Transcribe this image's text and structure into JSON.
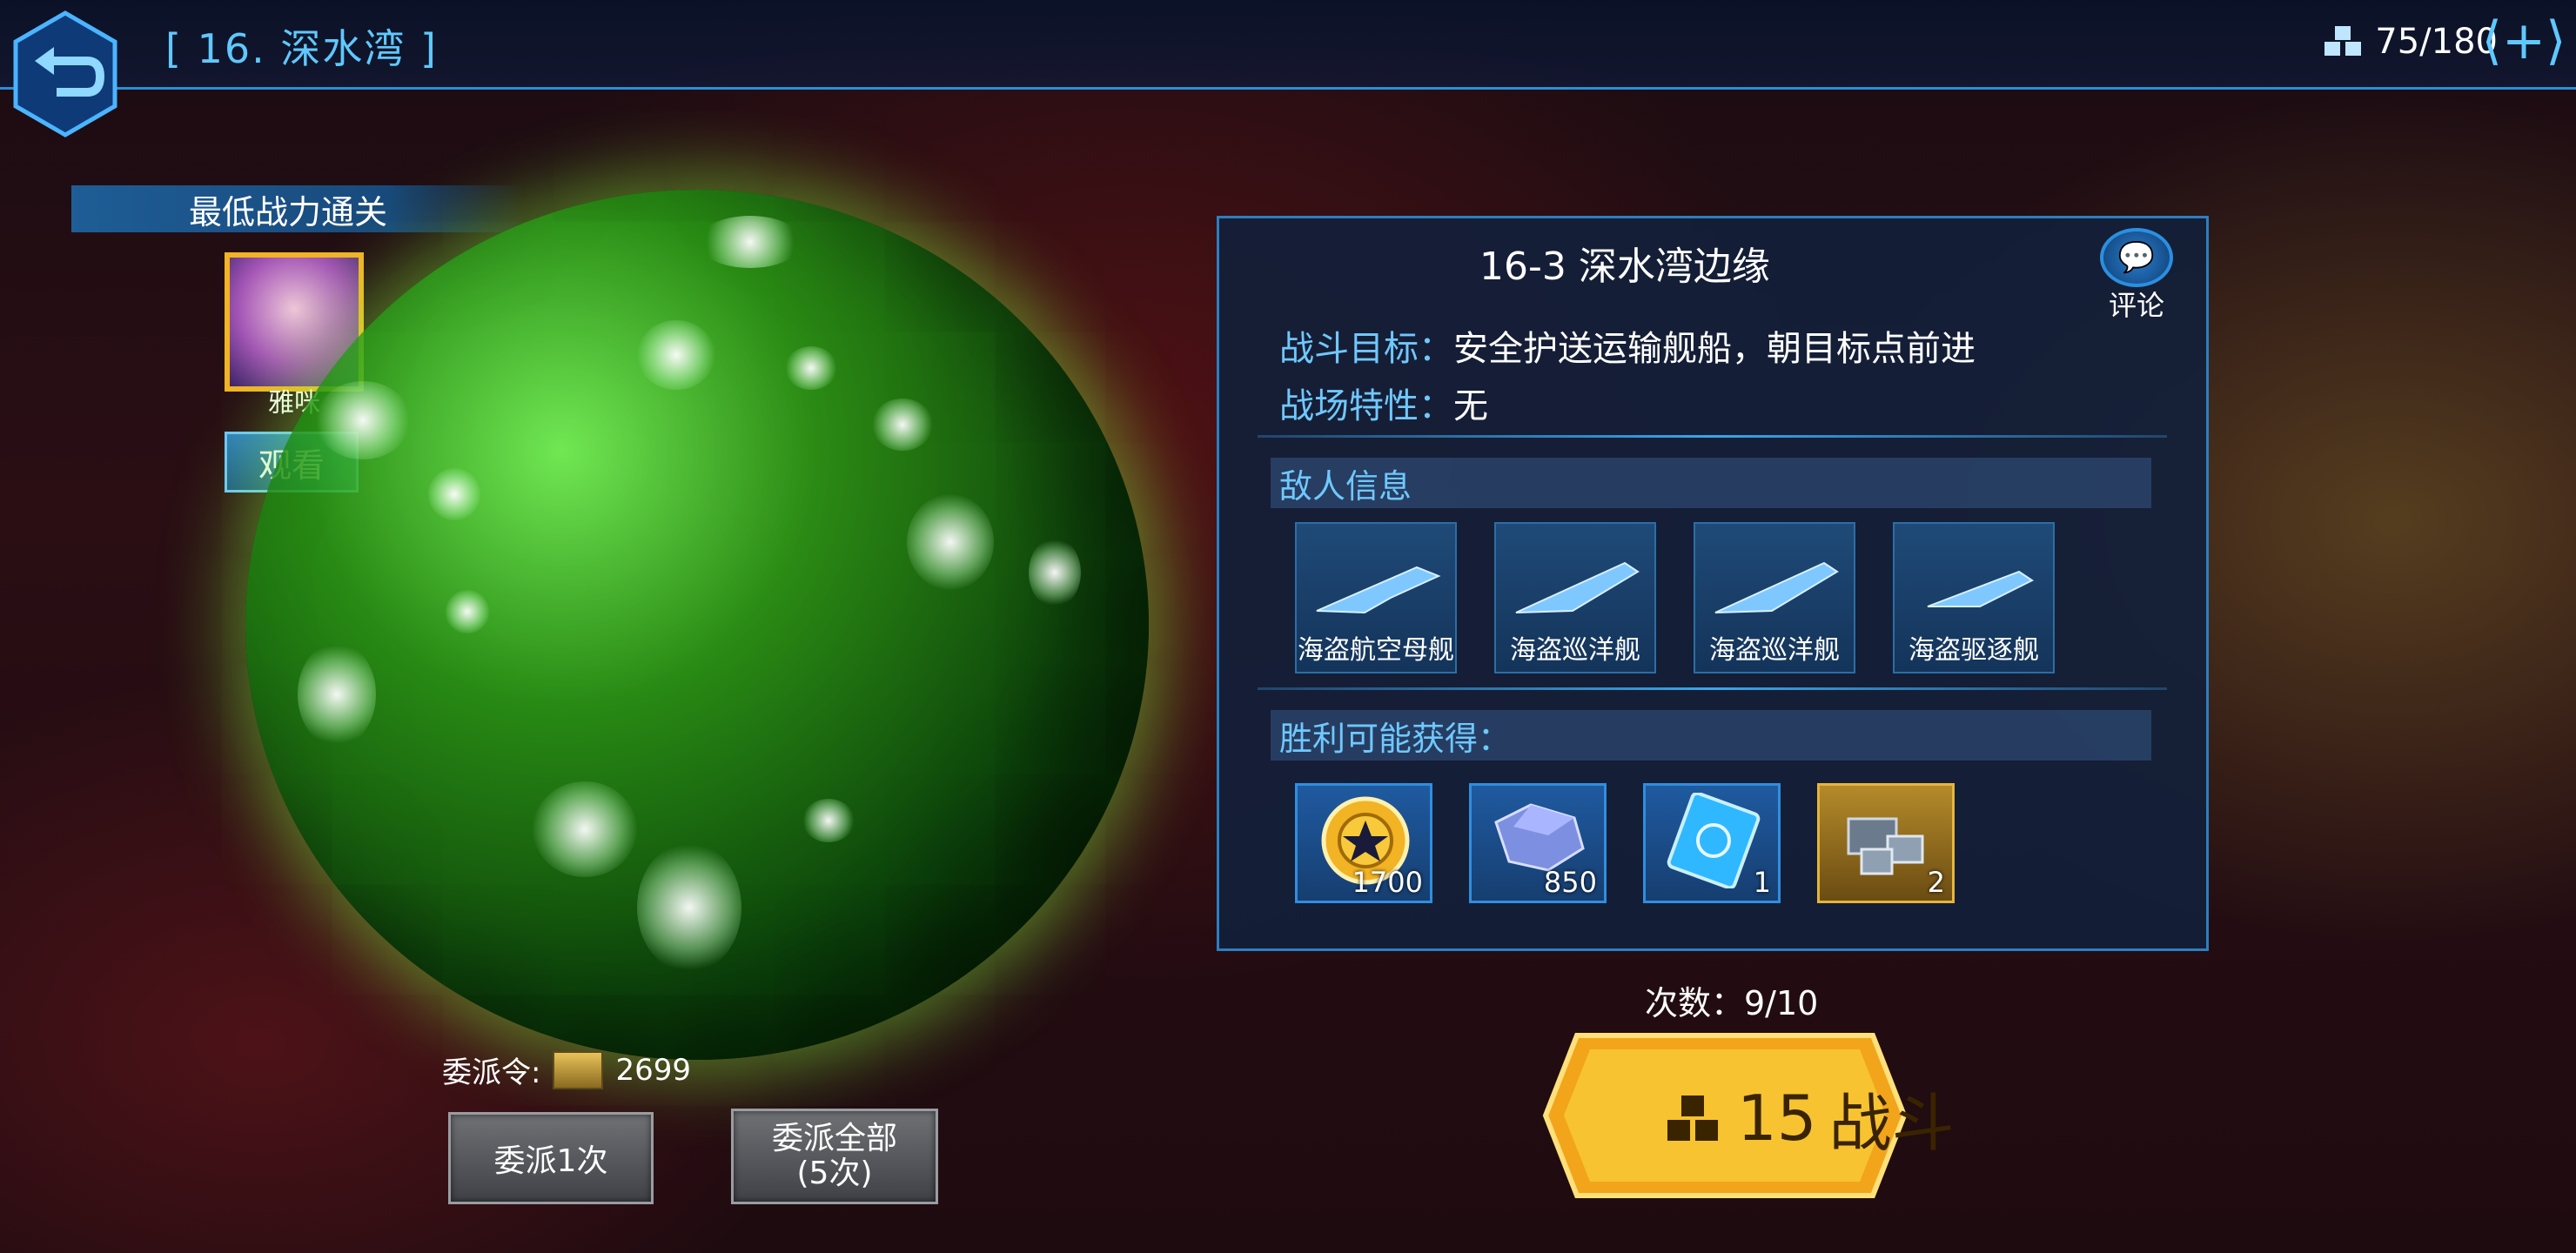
{
  "header": {
    "stage_title": "[ 16. 深水湾 ]",
    "energy": "75/180",
    "back_icon": "back-arrow-icon",
    "add_icon": "plus-icon"
  },
  "best_clear": {
    "header": "最低战力通关",
    "player_name": "雅咪",
    "watch_label": "观看"
  },
  "dispatch": {
    "label": "委派令:",
    "token_count": "2699",
    "once_label": "委派1次",
    "all_label_line1": "委派全部",
    "all_label_line2": "(5次)"
  },
  "panel": {
    "title": "16-3 深水湾边缘",
    "comment_label": "评论",
    "goal_key": "战斗目标：",
    "goal_value": "安全护送运输舰船，朝目标点前进",
    "field_key": "战场特性：",
    "field_value": "无",
    "enemy_header": "敌人信息",
    "enemies": [
      {
        "name": "海盗航空母舰"
      },
      {
        "name": "海盗巡洋舰"
      },
      {
        "name": "海盗巡洋舰"
      },
      {
        "name": "海盗驱逐舰"
      }
    ],
    "reward_header": "胜利可能获得：",
    "rewards": [
      {
        "icon": "gold-coin-icon",
        "count": "1700"
      },
      {
        "icon": "ore-crystal-icon",
        "count": "850"
      },
      {
        "icon": "blueprint-card-icon",
        "count": "1"
      },
      {
        "icon": "parts-crate-icon",
        "count": "2"
      }
    ]
  },
  "attempts": "次数：9/10",
  "battle": {
    "cost": "15",
    "label": "战斗"
  },
  "colors": {
    "accent": "#5fc8ff",
    "gold": "#f2b324",
    "planet": "#2fa014"
  }
}
